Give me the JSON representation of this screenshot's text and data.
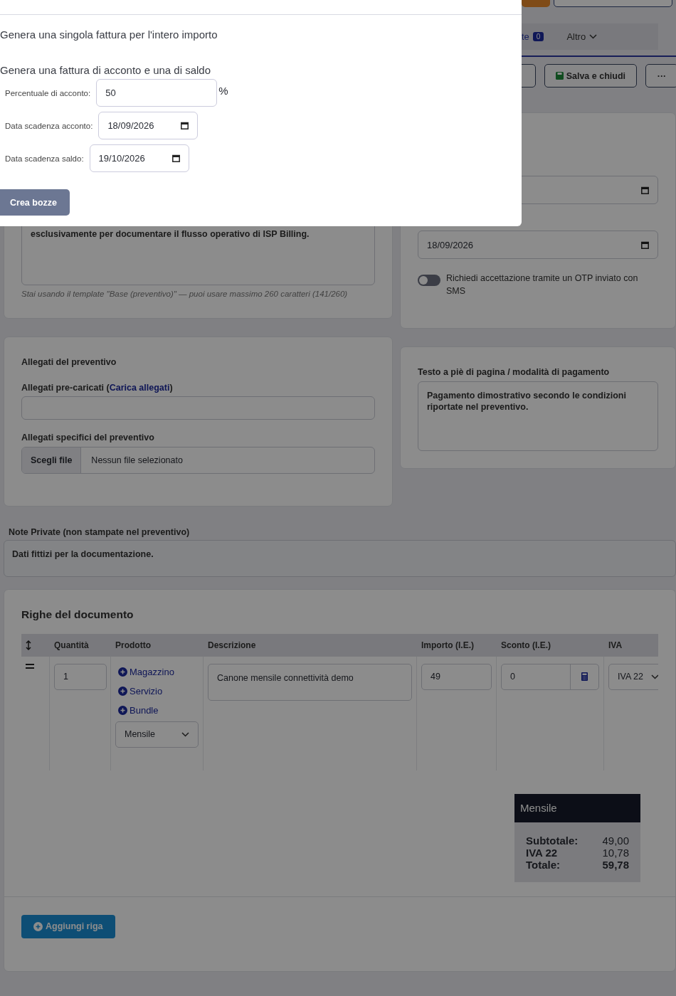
{
  "modal": {
    "options": [
      "Genera una singola fattura per l'intero importo",
      "Genera una fattura di acconto e una di saldo"
    ],
    "fields": [
      {
        "label": "Percentuale di acconto:",
        "value": "50",
        "suffix": "%",
        "kind": "number"
      },
      {
        "label": "Data scadenza acconto:",
        "value": "18/09/2026",
        "kind": "date"
      },
      {
        "label": "Data scadenza saldo:",
        "value": "19/10/2026",
        "kind": "date"
      }
    ],
    "submit": "Crea bozze"
  },
  "header": {
    "tabs": [
      {
        "label": "te",
        "badge": "0",
        "kind": "badge"
      },
      {
        "label": "Altro",
        "kind": "dropdown"
      }
    ],
    "buttons": [
      {
        "label": "Salva e chiudi",
        "kind": "save"
      },
      {
        "label": "···",
        "kind": "more"
      }
    ]
  },
  "notes_card": {
    "text": "esclusivamente per documentare il flusso operativo di ISP Billing.",
    "hint": "Stai usando il template \"Base (preventivo)\" — puoi usare massimo 260 caratteri (141/260)"
  },
  "settings_card": {
    "date": "18/09/2026",
    "otp": {
      "label": "Richiedi accettazione tramite un OTP inviato con SMS",
      "on": false
    }
  },
  "attachments": {
    "title": "Allegati del preventivo",
    "preloaded_before": "Allegati pre-caricati (",
    "preloaded_link": "Carica allegati",
    "preloaded_after": ")",
    "specific_label": "Allegati specifici del preventivo",
    "file_button": "Scegli file",
    "file_status": "Nessun file selezionato"
  },
  "footer_text": {
    "label": "Testo a piè di pagina / modalità di pagamento",
    "value": "Pagamento dimostrativo secondo le condizioni riportate nel preventivo."
  },
  "private_notes": {
    "label": "Note Private (non stampate nel preventivo)",
    "value": "Dati fittizi per la documentazione."
  },
  "lines": {
    "title": "Righe del documento",
    "columns": [
      "Quantità",
      "Prodotto",
      "Descrizione",
      "Importo (I.E.)",
      "Sconto (I.E.)",
      "IVA"
    ],
    "rows": [
      {
        "quantity": "1",
        "product_links": [
          "Magazzino",
          "Servizio",
          "Bundle"
        ],
        "period": "Mensile",
        "description": "Canone mensile connettività demo",
        "amount": "49",
        "discount": "0",
        "vat": "IVA 22"
      }
    ]
  },
  "totals": {
    "title": "Mensile",
    "rows": [
      {
        "label": "Subtotale:",
        "value": "49,00",
        "bold": false
      },
      {
        "label": "IVA 22",
        "value": "10,78",
        "bold": false
      },
      {
        "label": "Totale:",
        "value": "59,78",
        "bold": true
      }
    ]
  },
  "add_button": "Aggiungi riga"
}
